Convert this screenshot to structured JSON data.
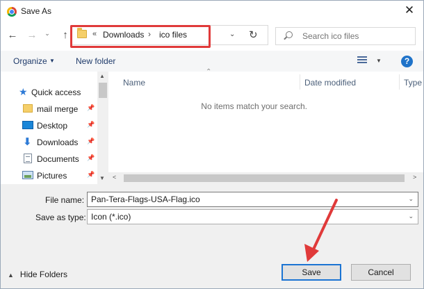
{
  "window": {
    "title": "Save As",
    "close_glyph": "✕"
  },
  "nav": {
    "back_glyph": "←",
    "forward_glyph": "→",
    "recent_glyph": "⌄",
    "up_glyph": "↑",
    "overflow_glyph": "«",
    "path": [
      "Downloads",
      "ico files"
    ],
    "separator_glyph": "›",
    "dropdown_glyph": "⌄",
    "refresh_glyph": "↻"
  },
  "search": {
    "placeholder": "Search ico files"
  },
  "toolbar": {
    "organize_label": "Organize",
    "organize_caret": "▼",
    "new_folder_label": "New folder",
    "view_caret": "▼",
    "help_glyph": "?"
  },
  "sidebar": {
    "quick_access_label": "Quick access",
    "items": [
      {
        "label": "mail merge",
        "icon": "folder-icon"
      },
      {
        "label": "Desktop",
        "icon": "desktop-icon"
      },
      {
        "label": "Downloads",
        "icon": "download-icon"
      },
      {
        "label": "Documents",
        "icon": "documents-icon"
      },
      {
        "label": "Pictures",
        "icon": "pictures-icon"
      }
    ],
    "pin_glyph": "📌",
    "scroll_up_glyph": "▲",
    "scroll_down_glyph": "▼"
  },
  "file_list": {
    "sort_glyph": "⌃",
    "columns": [
      "Name",
      "Date modified",
      "Type"
    ],
    "empty_message": "No items match your search.",
    "scroll_left_glyph": "<",
    "scroll_right_glyph": ">"
  },
  "form": {
    "filename_label": "File name:",
    "filename_value": "Pan-Tera-Flags-USA-Flag.ico",
    "savetype_label": "Save as type:",
    "savetype_value": "Icon (*.ico)",
    "caret_glyph": "⌄"
  },
  "footer": {
    "hide_folders_glyph": "▲",
    "hide_folders_label": "Hide Folders",
    "save_label": "Save",
    "cancel_label": "Cancel"
  },
  "colors": {
    "annotation": "#e03a3a",
    "accent": "#1b74d3",
    "help_button": "#1f73c9"
  }
}
